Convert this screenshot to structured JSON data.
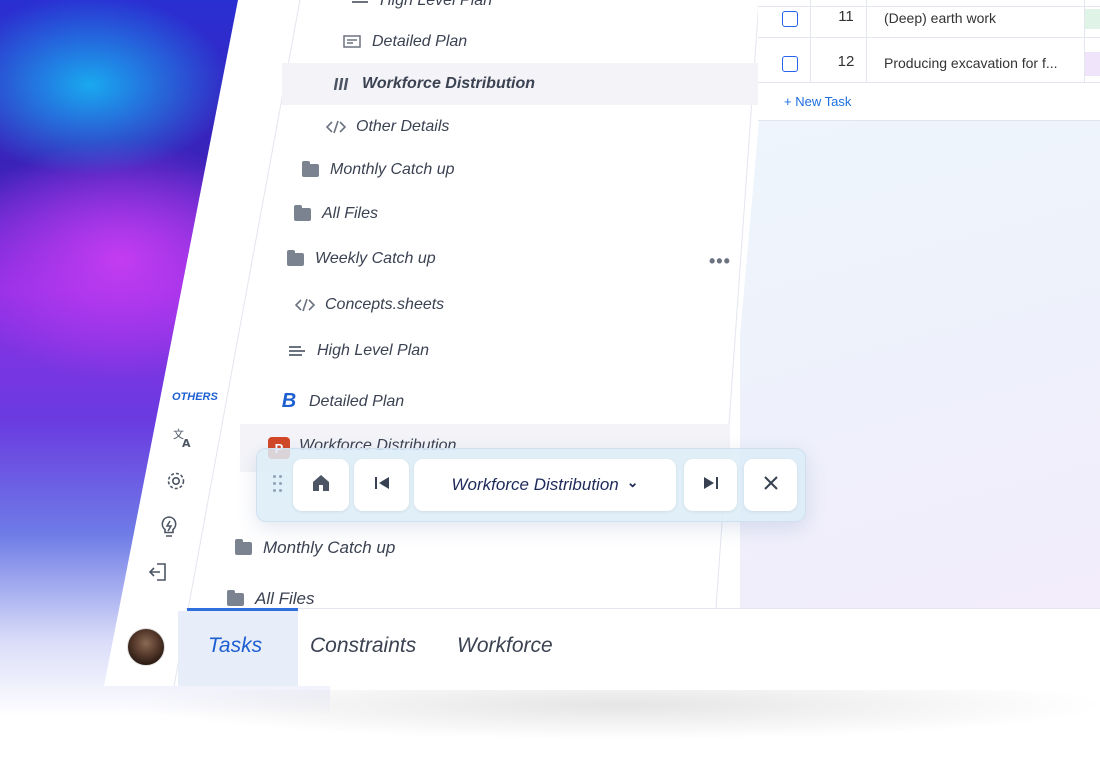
{
  "navigation_tree": {
    "items": [
      {
        "label": "High Level Plan"
      },
      {
        "label": "Detailed Plan"
      },
      {
        "label": "Workforce Distribution"
      },
      {
        "label": "Other Details"
      },
      {
        "label": "Monthly Catch up"
      },
      {
        "label": "All Files"
      },
      {
        "label": "Weekly Catch up"
      },
      {
        "label": "Concepts.sheets"
      },
      {
        "label": "High Level Plan"
      },
      {
        "label": "Detailed Plan"
      },
      {
        "label": "Workforce Distribution"
      },
      {
        "label": "Monthly Catch up"
      },
      {
        "label": "All Files"
      }
    ],
    "more_glyph": "•••",
    "detailed_plan_icon_letter": "B",
    "ppt_icon_letter": "P"
  },
  "sidebar": {
    "section_label": "OTHERS",
    "icons": [
      "translate-icon",
      "settings-icon",
      "lightbulb-icon",
      "logout-icon"
    ]
  },
  "task_table": {
    "rows": [
      {
        "number": "11",
        "name": "(Deep) earth work"
      },
      {
        "number": "12",
        "name": "Producing excavation for f..."
      }
    ],
    "new_task_label": "+ New Task"
  },
  "floating_toolbar": {
    "title": "Workforce Distribution",
    "dropdown_glyph": "⌄"
  },
  "bottom_tabs": [
    {
      "label": "Tasks",
      "active": true
    },
    {
      "label": "Constraints",
      "active": false
    },
    {
      "label": "Workforce",
      "active": false
    }
  ],
  "colors": {
    "accent": "#2f6fdb",
    "active_tab_bg": "#e7eef9",
    "ppt_red": "#d24726",
    "brand_b": "#1d5fd1"
  }
}
